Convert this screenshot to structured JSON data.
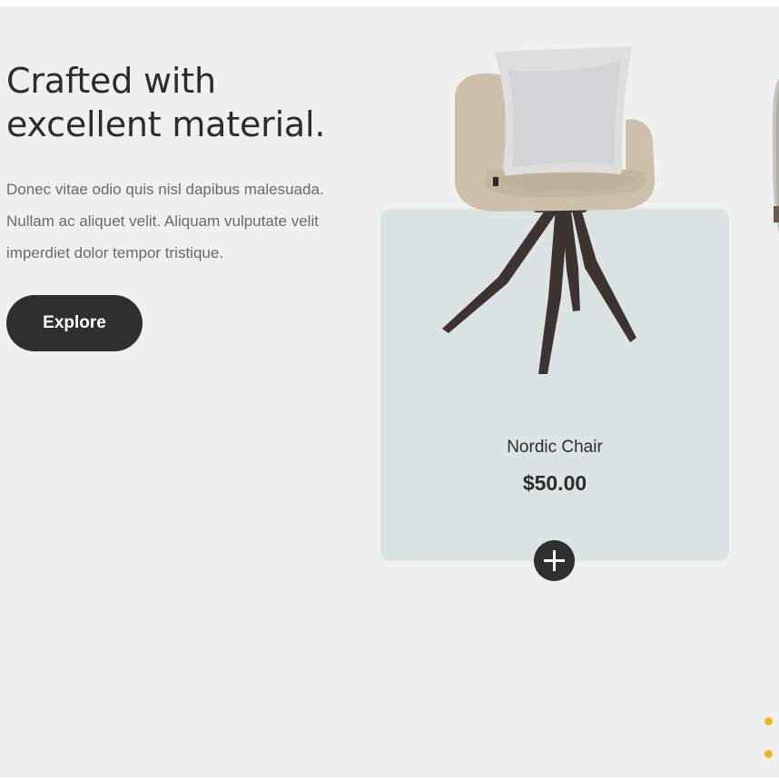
{
  "hero": {
    "title_line1": "Crafted with",
    "title_line2": "excellent material.",
    "description_line1": "Donec vitae odio quis nisl dapibus malesuada.",
    "description_line2": "Nullam ac aliquet velit. Aliquam vulputate velit",
    "description_line3": "imperdiet dolor tempor tristique.",
    "explore_label": "Explore"
  },
  "product": {
    "name": "Nordic Chair",
    "price": "$50.00",
    "image_icon": "chair-image",
    "add_icon": "plus-icon"
  },
  "colors": {
    "page_background": "#eff1f0",
    "card_background": "#dce3e3",
    "button_dark": "#2f2f2f",
    "accent_dots": "#f4b719"
  }
}
